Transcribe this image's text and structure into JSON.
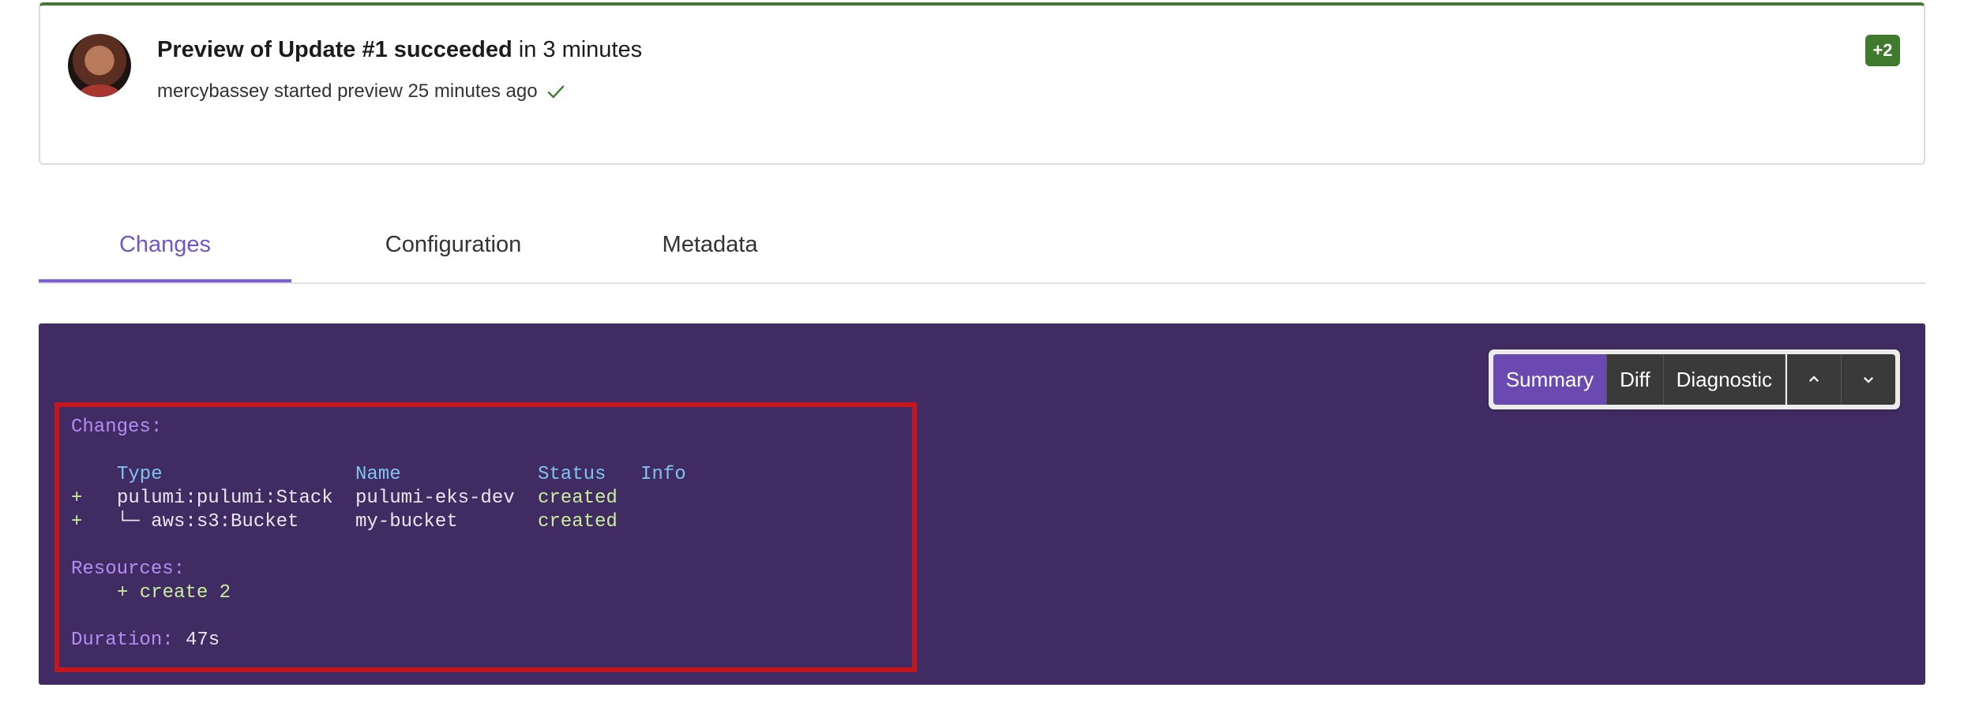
{
  "update": {
    "title": "Preview of Update #1 succeeded",
    "duration_text": "in 3 minutes",
    "subtitle": "mercybassey started preview 25 minutes ago",
    "badge": "+2",
    "accent": "#3f7a2f"
  },
  "tabs": [
    {
      "label": "Changes",
      "active": true
    },
    {
      "label": "Configuration",
      "active": false
    },
    {
      "label": "Metadata",
      "active": false
    }
  ],
  "toolbar": {
    "summary": "Summary",
    "diff": "Diff",
    "diagnostic": "Diagnostic",
    "up_icon": "chevron-up-icon",
    "down_icon": "chevron-down-icon"
  },
  "console": {
    "changes_label": "Changes:",
    "headers": {
      "type": "Type",
      "name": "Name",
      "status": "Status",
      "info": "Info"
    },
    "rows": [
      {
        "op": "+",
        "type": "pulumi:pulumi:Stack",
        "name": "pulumi-eks-dev",
        "status": "created"
      },
      {
        "op": "+",
        "type": "└─ aws:s3:Bucket",
        "name": "my-bucket",
        "status": "created"
      }
    ],
    "resources_label": "Resources:",
    "resources_value": "+ create 2",
    "duration_label": "Duration:",
    "duration_value": "47s",
    "background": "#402c62"
  }
}
